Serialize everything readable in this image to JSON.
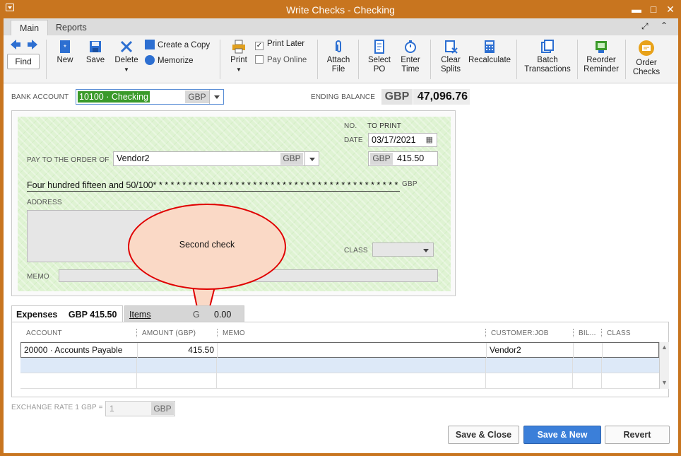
{
  "window": {
    "title": "Write Checks - Checking"
  },
  "tabs": {
    "main": "Main",
    "reports": "Reports"
  },
  "toolbar": {
    "find": "Find",
    "new": "New",
    "save": "Save",
    "delete": "Delete",
    "create_copy": "Create a Copy",
    "memorize": "Memorize",
    "print": "Print",
    "print_later": "Print Later",
    "pay_online": "Pay Online",
    "attach_file": [
      "Attach",
      "File"
    ],
    "select_po": [
      "Select",
      "PO"
    ],
    "enter_time": [
      "Enter",
      "Time"
    ],
    "clear_splits": [
      "Clear",
      "Splits"
    ],
    "recalculate": "Recalculate",
    "batch_transactions": [
      "Batch",
      "Transactions"
    ],
    "reorder_reminder": [
      "Reorder",
      "Reminder"
    ],
    "order_checks": [
      "Order",
      "Checks"
    ]
  },
  "header": {
    "bank_account_label": "BANK ACCOUNT",
    "bank_account_value": "10100 · Checking",
    "bank_currency": "GBP",
    "ending_balance_label": "ENDING BALANCE",
    "ending_balance_currency": "GBP",
    "ending_balance_value": "47,096.76"
  },
  "check": {
    "no_label": "NO.",
    "no_value": "TO PRINT",
    "date_label": "DATE",
    "date_value": "03/17/2021",
    "pay_to_label": "PAY TO THE ORDER OF",
    "payee": "Vendor2",
    "payee_currency": "GBP",
    "amount_currency": "GBP",
    "amount": "415.50",
    "amount_words": "Four hundred fifteen and 50/100* * * * * * * * * * * * * * * * * * * * * * * * * * * * * * * * * * * * * * * * * * * * *",
    "words_currency": "GBP",
    "address_label": "ADDRESS",
    "class_label": "CLASS",
    "memo_label": "MEMO"
  },
  "callout": {
    "text": "Second check",
    "fill": "#fad9c6",
    "stroke": "#e00000"
  },
  "detail_tabs": {
    "expenses_label": "Expenses",
    "expenses_amount": "GBP  415.50",
    "items_label": "Items",
    "items_amount": "0.00",
    "items_currency_fragment": "G"
  },
  "grid": {
    "columns": [
      "ACCOUNT",
      "AMOUNT (GBP)",
      "MEMO",
      "CUSTOMER:JOB",
      "BIL...",
      "CLASS"
    ],
    "rows": [
      {
        "account": "20000 · Accounts Payable",
        "amount": "415.50",
        "memo": "",
        "customer_job": "Vendor2",
        "billable": "",
        "class": ""
      },
      {
        "account": "",
        "amount": "",
        "memo": "",
        "customer_job": "",
        "billable": "",
        "class": ""
      },
      {
        "account": "",
        "amount": "",
        "memo": "",
        "customer_job": "",
        "billable": "",
        "class": ""
      }
    ]
  },
  "exchange": {
    "label": "EXCHANGE RATE 1 GBP =",
    "value": "1",
    "currency": "GBP"
  },
  "buttons": {
    "save_close": "Save & Close",
    "save_new": "Save & New",
    "revert": "Revert"
  },
  "colors": {
    "titlebar": "#c8751f",
    "accent": "#3b7fd9",
    "check_bg": "#dff3d3",
    "bank_highlight": "#3a9a2a"
  }
}
